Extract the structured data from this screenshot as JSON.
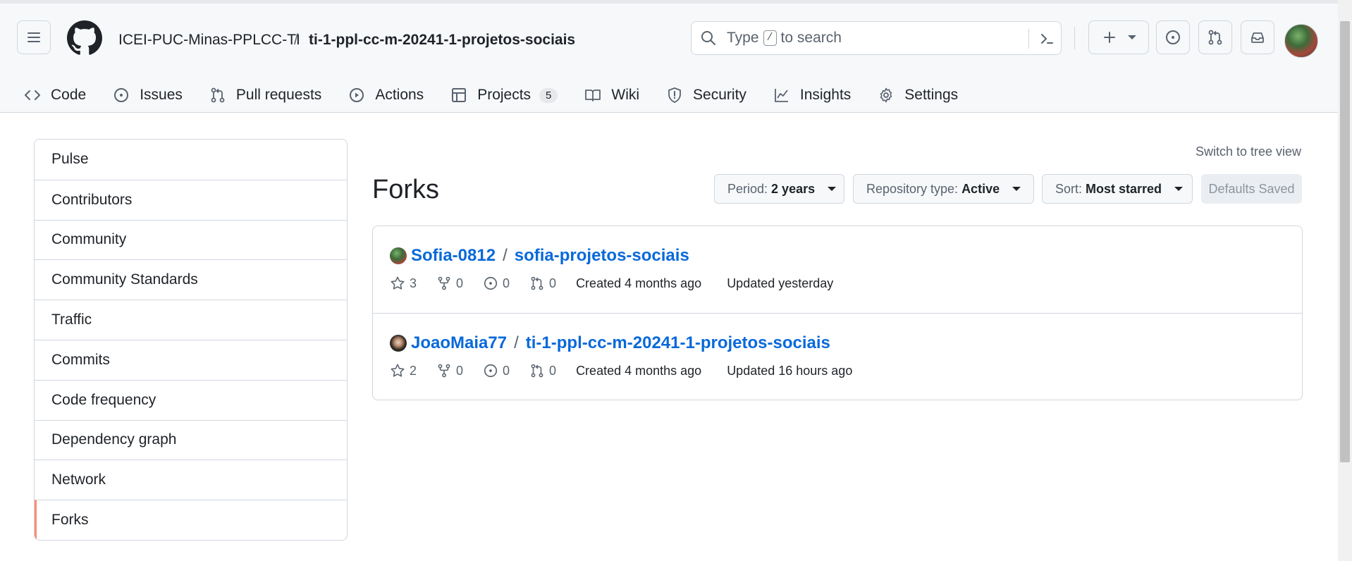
{
  "header": {
    "org": "ICEI-PUC-Minas-PPLCC-TI",
    "separator": "/",
    "repo": "ti-1-ppl-cc-m-20241-1-projetos-sociais",
    "search": {
      "before": "Type",
      "key": "/",
      "after": "to search"
    }
  },
  "tabs": [
    {
      "label": "Code",
      "icon": "code-icon"
    },
    {
      "label": "Issues",
      "icon": "issue-icon"
    },
    {
      "label": "Pull requests",
      "icon": "pull-request-icon"
    },
    {
      "label": "Actions",
      "icon": "play-icon"
    },
    {
      "label": "Projects",
      "icon": "table-icon",
      "count": "5"
    },
    {
      "label": "Wiki",
      "icon": "book-icon"
    },
    {
      "label": "Security",
      "icon": "shield-icon"
    },
    {
      "label": "Insights",
      "icon": "graph-icon"
    },
    {
      "label": "Settings",
      "icon": "gear-icon"
    }
  ],
  "sidebar": {
    "items": [
      {
        "label": "Pulse"
      },
      {
        "label": "Contributors"
      },
      {
        "label": "Community"
      },
      {
        "label": "Community Standards"
      },
      {
        "label": "Traffic"
      },
      {
        "label": "Commits"
      },
      {
        "label": "Code frequency"
      },
      {
        "label": "Dependency graph"
      },
      {
        "label": "Network"
      },
      {
        "label": "Forks",
        "selected": true
      }
    ]
  },
  "main": {
    "switch_link": "Switch to tree view",
    "title": "Forks",
    "filters": {
      "period": {
        "label": "Period:",
        "value": "2 years"
      },
      "repo_type": {
        "label": "Repository type:",
        "value": "Active"
      },
      "sort": {
        "label": "Sort:",
        "value": "Most starred"
      },
      "defaults": "Defaults Saved"
    },
    "forks": [
      {
        "owner": "Sofia-0812",
        "repo": "sofia-projetos-sociais",
        "stars": "3",
        "forks": "0",
        "issues": "0",
        "pulls": "0",
        "created": "Created 4 months ago",
        "updated": "Updated yesterday"
      },
      {
        "owner": "JoaoMaia77",
        "repo": "ti-1-ppl-cc-m-20241-1-projetos-sociais",
        "stars": "2",
        "forks": "0",
        "issues": "0",
        "pulls": "0",
        "created": "Created 4 months ago",
        "updated": "Updated 16 hours ago"
      }
    ]
  },
  "colors": {
    "link": "#0969da",
    "selected_accent": "#fd8c73",
    "border": "#d0d7de"
  }
}
